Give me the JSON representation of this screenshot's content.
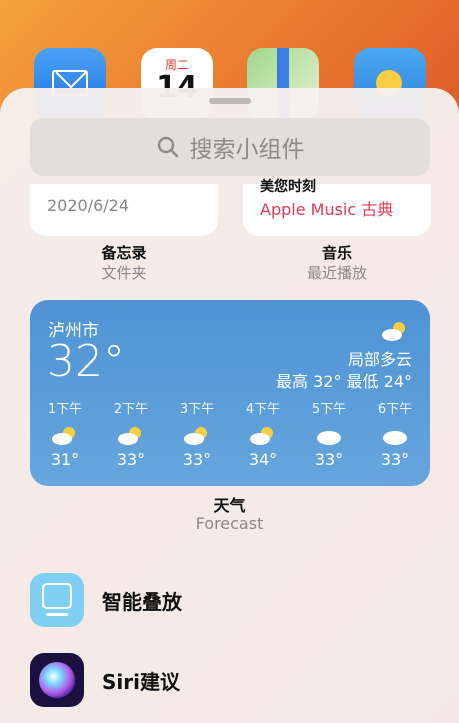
{
  "home_apps": {
    "calendar_weekday": "周二",
    "calendar_day": "14"
  },
  "search": {
    "placeholder": "搜索小组件",
    "icon": "search-icon"
  },
  "notes_widget": {
    "date": "2020/6/24",
    "title": "备忘录",
    "subtitle": "文件夹"
  },
  "music_widget": {
    "top_text": "美您时刻",
    "playlist": "Apple Music 古典",
    "title": "音乐",
    "subtitle": "最近播放"
  },
  "weather_widget": {
    "city": "泸州市",
    "temperature": "32°",
    "condition": "局部多云",
    "high_low": "最高 32° 最低 24°",
    "hours": [
      {
        "time": "1下午",
        "icon": "partly-sunny-icon",
        "temp": "31°"
      },
      {
        "time": "2下午",
        "icon": "partly-sunny-icon",
        "temp": "33°"
      },
      {
        "time": "3下午",
        "icon": "partly-sunny-icon",
        "temp": "33°"
      },
      {
        "time": "4下午",
        "icon": "partly-sunny-icon",
        "temp": "34°"
      },
      {
        "time": "5下午",
        "icon": "cloud-icon",
        "temp": "33°"
      },
      {
        "time": "6下午",
        "icon": "cloud-icon",
        "temp": "33°"
      }
    ],
    "title": "天气",
    "subtitle": "Forecast"
  },
  "widget_list": [
    {
      "label": "智能叠放",
      "icon": "smart-stack-icon"
    },
    {
      "label": "Siri建议",
      "icon": "siri-icon"
    }
  ],
  "colors": {
    "music_accent": "#e23b54",
    "weather_bg": "#5a9ad8",
    "search_bg": "#e3dedc"
  }
}
